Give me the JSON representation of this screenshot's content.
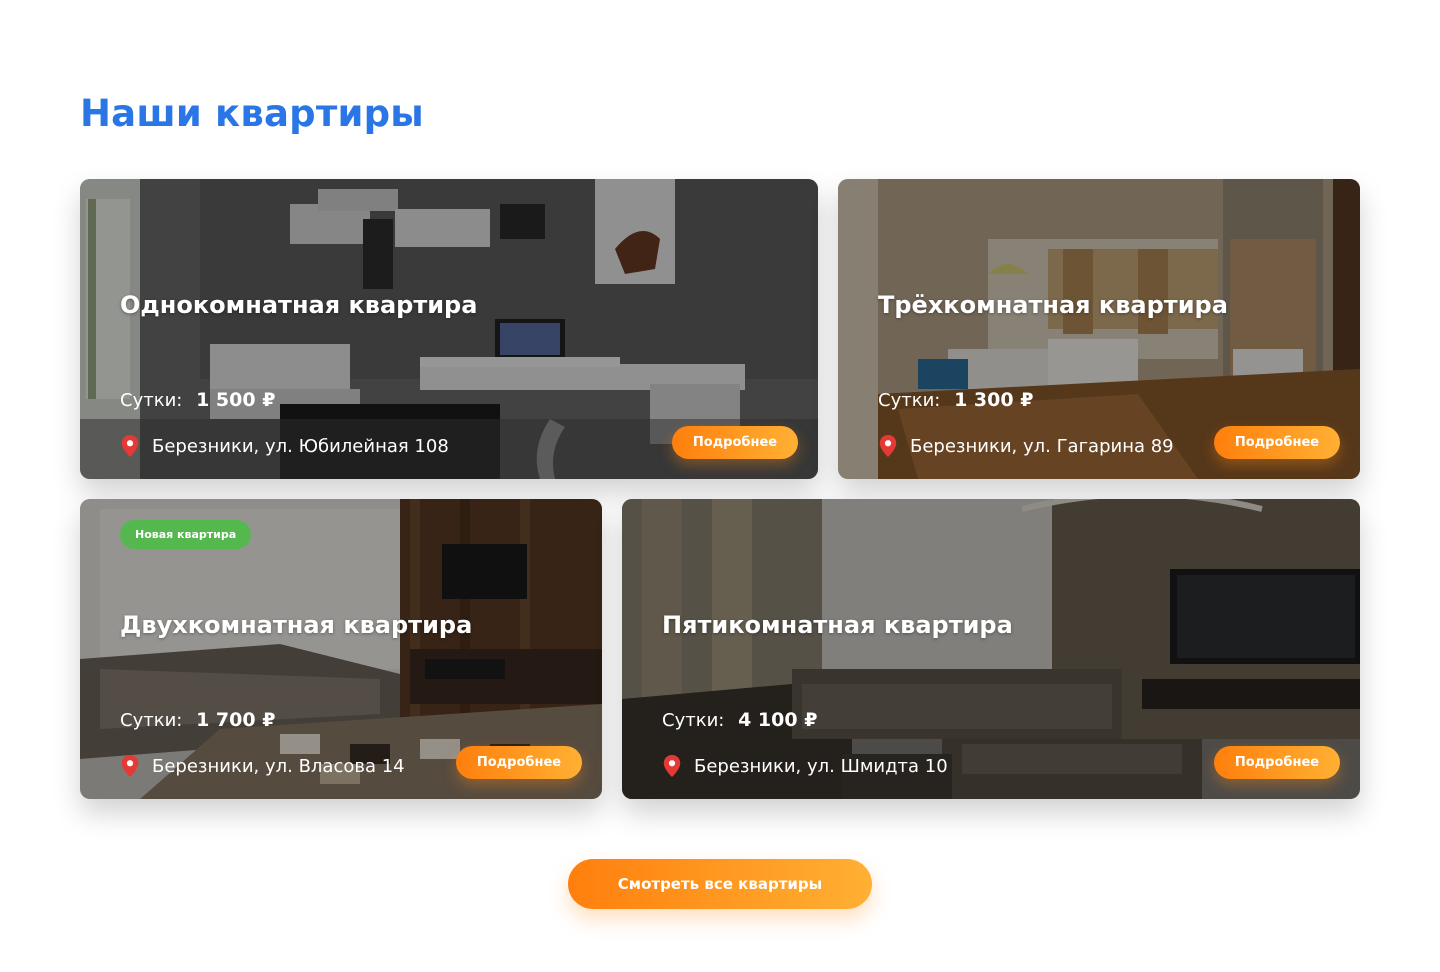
{
  "section": {
    "title": "Наши квартиры"
  },
  "apartments": [
    {
      "title": "Однокомнатная квартира",
      "price_label": "Сутки:",
      "price": "1 500 ₽",
      "address": "Березники, ул. Юбилейная 108",
      "button": "Подробнее"
    },
    {
      "title": "Трёхкомнатная квартира",
      "price_label": "Сутки:",
      "price": "1 300 ₽",
      "address": "Березники, ул. Гагарина 89",
      "button": "Подробнее"
    },
    {
      "title": "Двухкомнатная квартира",
      "badge": "Новая квартира",
      "price_label": "Сутки:",
      "price": "1 700 ₽",
      "address": "Березники, ул. Власова 14",
      "button": "Подробнее"
    },
    {
      "title": "Пятикомнатная квартира",
      "price_label": "Сутки:",
      "price": "4 100 ₽",
      "address": "Березники, ул. Шмидта 10",
      "button": "Подробнее"
    }
  ],
  "all_button": "Смотреть все квартиры",
  "colors": {
    "title_blue": "#2a76e6",
    "accent_orange_start": "#ff7f0d",
    "accent_orange_end": "#ffb033",
    "badge_green": "#55b84f",
    "pin_red": "#e53935"
  },
  "icons": {
    "location": "map-pin-icon"
  }
}
